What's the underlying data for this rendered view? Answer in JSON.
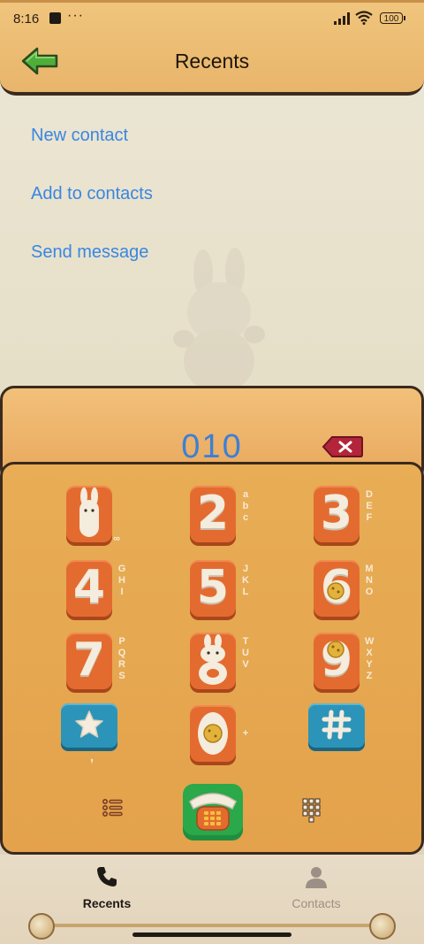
{
  "status_bar": {
    "time": "8:16",
    "more": "···",
    "battery": "100"
  },
  "header": {
    "title": "Recents"
  },
  "menu": {
    "items": [
      {
        "label": "New contact"
      },
      {
        "label": "Add to contacts"
      },
      {
        "label": "Send message"
      }
    ]
  },
  "dialer": {
    "number": "010",
    "keys": [
      {
        "digit": "",
        "letters": "∞"
      },
      {
        "digit": "2",
        "letters": "abc"
      },
      {
        "digit": "3",
        "letters": "DEF"
      },
      {
        "digit": "4",
        "letters": "GHI"
      },
      {
        "digit": "5",
        "letters": "JKL"
      },
      {
        "digit": "6",
        "letters": "MNO"
      },
      {
        "digit": "7",
        "letters": "PQRS"
      },
      {
        "digit": "",
        "letters": "TUV"
      },
      {
        "digit": "9",
        "letters": "WXYZ"
      }
    ],
    "star_sub": ",",
    "zero_sub": "+",
    "colors": {
      "key_orange": "#e46b2f",
      "key_blue": "#2c94b8",
      "call_green": "#2aa84a",
      "number": "#3d7fd6"
    }
  },
  "bottom_nav": {
    "items": [
      {
        "label": "Recents",
        "active": true
      },
      {
        "label": "Contacts",
        "active": false
      }
    ]
  },
  "accent": "#3a86e0"
}
